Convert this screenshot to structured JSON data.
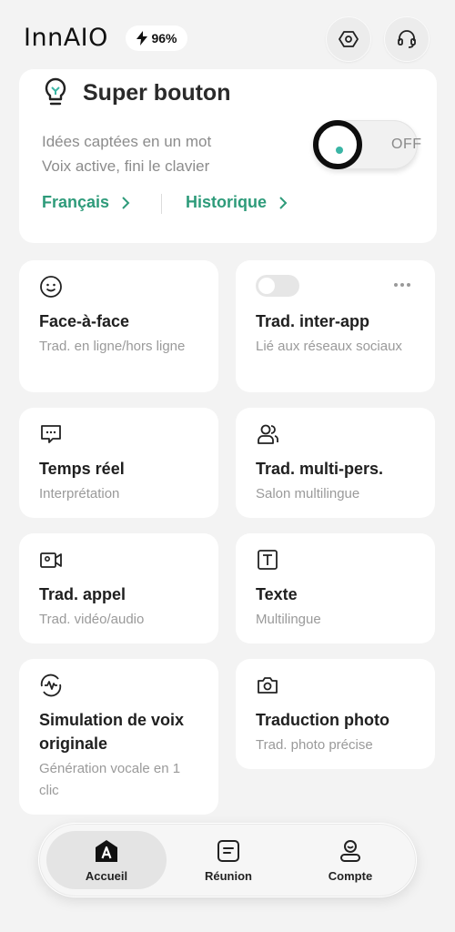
{
  "header": {
    "logo": "InnAIO",
    "battery": "96%"
  },
  "super": {
    "title": "Super bouton",
    "desc_line1": "Idées captées en un mot",
    "desc_line2": "Voix active, fini le clavier",
    "toggle_state": "OFF",
    "link_language": "Français",
    "link_history": "Historique",
    "accent": "#2e9b7a"
  },
  "cards": {
    "face": {
      "title": "Face-à-face",
      "sub": "Trad. en ligne/hors ligne"
    },
    "interapp": {
      "title": "Trad. inter-app",
      "sub": "Lié aux réseaux sociaux"
    },
    "realtime": {
      "title": "Temps réel",
      "sub": "Interprétation"
    },
    "multi": {
      "title": "Trad. multi-pers.",
      "sub": "Salon multilingue"
    },
    "call": {
      "title": "Trad. appel",
      "sub": "Trad. vidéo/audio"
    },
    "text": {
      "title": "Texte",
      "sub": "Multilingue"
    },
    "voice": {
      "title_line1": "Simulation de voix",
      "title_line2": "originale",
      "sub": "Génération vocale en 1 clic"
    },
    "photo": {
      "title": "Traduction photo",
      "sub": "Trad. photo précise"
    }
  },
  "nav": {
    "home": "Accueil",
    "meeting": "Réunion",
    "account": "Compte"
  }
}
